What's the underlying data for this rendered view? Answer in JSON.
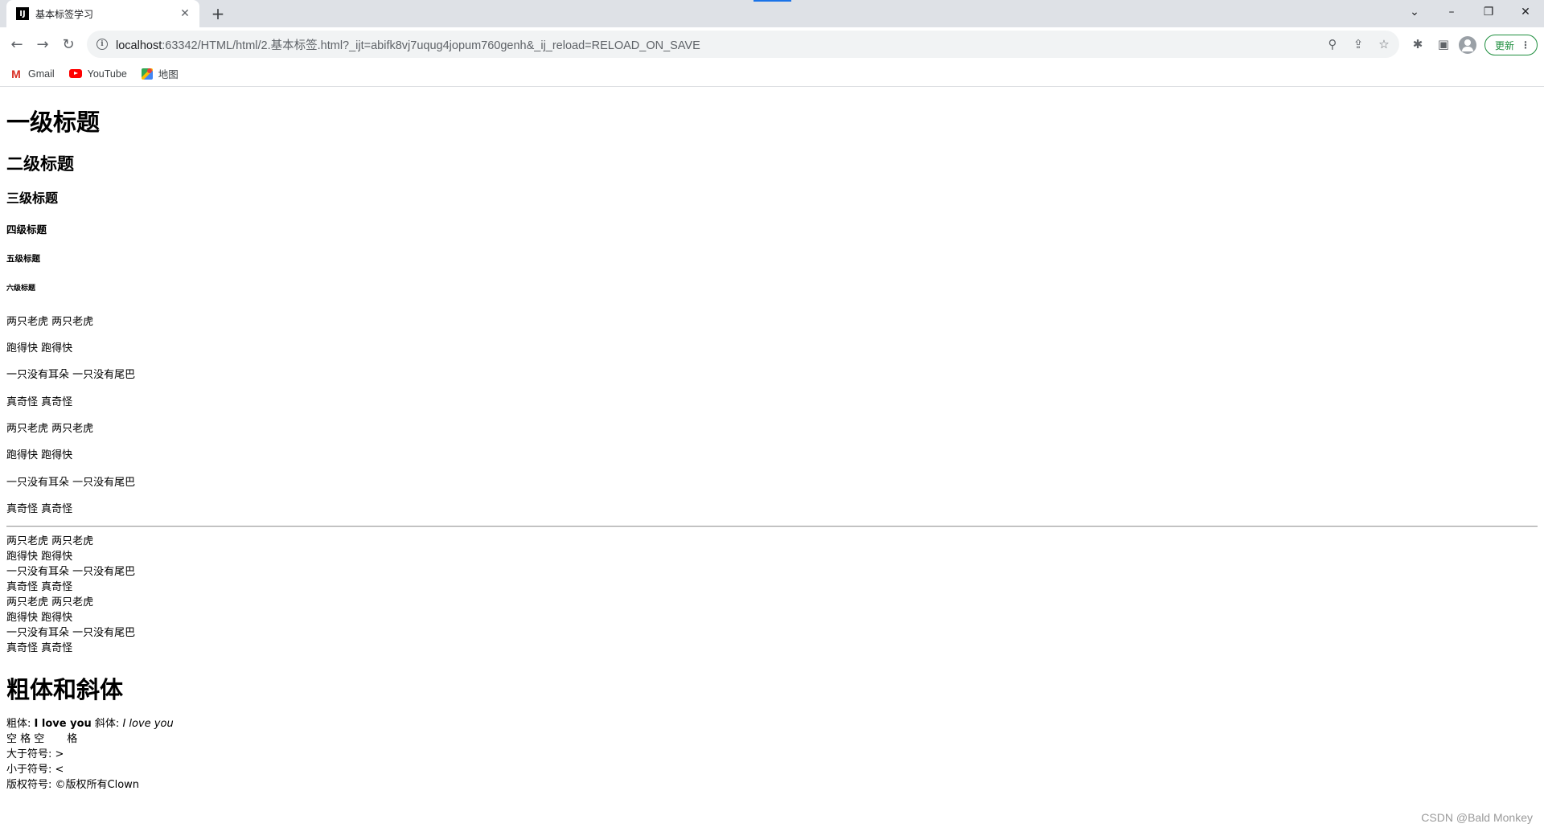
{
  "browser": {
    "tab": {
      "favicon": "IJ",
      "title": "基本标签学习"
    },
    "omnibox": {
      "host": "localhost",
      "rest": ":63342/HTML/html/2.基本标签.html?_ijt=abifk8vj7uqug4jopum760genh&_ij_reload=RELOAD_ON_SAVE"
    },
    "update_label": "更新",
    "bookmarks": [
      {
        "label": "Gmail",
        "icon": "gmail-icon"
      },
      {
        "label": "YouTube",
        "icon": "youtube-icon"
      },
      {
        "label": "地图",
        "icon": "maps-icon"
      }
    ],
    "glyphs": {
      "back": "←",
      "forward": "→",
      "reload": "↻",
      "newtab": "+",
      "close": "✕",
      "tablist": "⌄",
      "minimize": "–",
      "restore": "❐",
      "win_close": "✕",
      "zoom": "⚲",
      "share": "⇪",
      "star": "☆",
      "extensions": "✱",
      "sidepanel": "▣",
      "menu": "⋮"
    }
  },
  "page": {
    "headings": {
      "h1": "一级标题",
      "h2": "二级标题",
      "h3": "三级标题",
      "h4": "四级标题",
      "h5": "五级标题",
      "h6": "六级标题"
    },
    "paragraphs": [
      "两只老虎 两只老虎",
      "跑得快 跑得快",
      "一只没有耳朵 一只没有尾巴",
      "真奇怪 真奇怪",
      "两只老虎 两只老虎",
      "跑得快 跑得快",
      "一只没有耳朵 一只没有尾巴",
      "真奇怪 真奇怪"
    ],
    "br_lines": [
      "两只老虎 两只老虎",
      "跑得快 跑得快",
      "一只没有耳朵 一只没有尾巴",
      "真奇怪 真奇怪",
      "两只老虎 两只老虎",
      "跑得快 跑得快",
      "一只没有耳朵 一只没有尾巴",
      "真奇怪 真奇怪"
    ],
    "bold_italic_heading": "粗体和斜体",
    "bold_label": "粗体:",
    "bold_text": "I love you",
    "italic_label": "斜体:",
    "italic_text": "I love you",
    "space_a": "空 格 空",
    "space_b": "格",
    "gt_line": "大于符号: >",
    "lt_line": "小于符号: <",
    "copyright_line": "版权符号: ©版权所有Clown"
  },
  "watermark": "CSDN @Bald Monkey"
}
